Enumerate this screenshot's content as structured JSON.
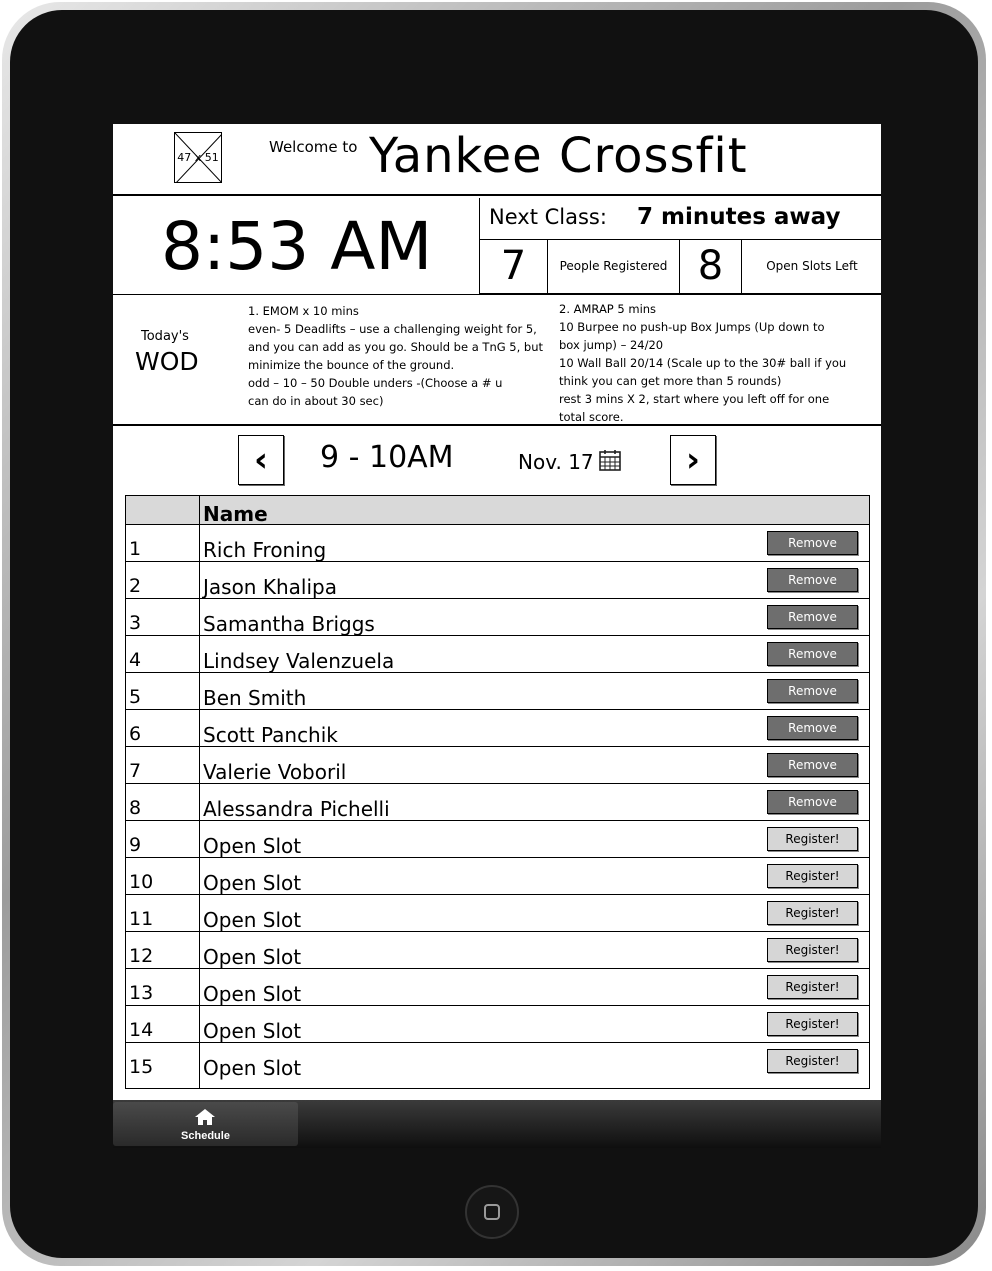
{
  "header": {
    "logo_text": "47 x 51",
    "welcome": "Welcome to",
    "title": "Yankee Crossfit"
  },
  "clock": "8:53 AM",
  "next_class": {
    "label": "Next Class:",
    "value": "7 minutes away"
  },
  "stats": {
    "registered_count": "7",
    "registered_label": "People Registered",
    "open_count": "8",
    "open_label": "Open Slots Left"
  },
  "wod": {
    "today": "Today's",
    "label": "WOD",
    "part1": [
      "1. EMOM x 10 mins",
      "even- 5 Deadlifts – use a challenging weight for 5,",
      "and you can add as you go. Should be a TnG 5, but",
      "minimize the bounce of the ground.",
      "odd – 10 – 50 Double unders -(Choose a # u",
      "can do in about 30 sec)"
    ],
    "part2": [
      "2. AMRAP 5 mins",
      "10 Burpee no push-up Box Jumps  (Up down to",
      "box jump) – 24/20",
      "10 Wall Ball 20/14 (Scale up to the 30# ball if you",
      "think you can get more than 5 rounds)",
      "rest 3 mins  X 2, start where you left off for one",
      "total score."
    ]
  },
  "schedule": {
    "slot": "9 - 10AM",
    "date": "Nov. 17",
    "prev_icon": "chevron-left-icon",
    "next_icon": "chevron-right-icon",
    "calendar_icon": "calendar-icon"
  },
  "table": {
    "header_name": "Name",
    "rows": [
      {
        "num": "1",
        "name": "Rich Froning",
        "action": "Remove"
      },
      {
        "num": "2",
        "name": "Jason Khalipa",
        "action": "Remove"
      },
      {
        "num": "3",
        "name": "Samantha Briggs",
        "action": "Remove"
      },
      {
        "num": "4",
        "name": "Lindsey Valenzuela",
        "action": "Remove"
      },
      {
        "num": "5",
        "name": "Ben Smith",
        "action": "Remove"
      },
      {
        "num": "6",
        "name": "Scott Panchik",
        "action": "Remove"
      },
      {
        "num": "7",
        "name": "Valerie Voboril",
        "action": "Remove"
      },
      {
        "num": "8",
        "name": "Alessandra Pichelli",
        "action": "Remove"
      },
      {
        "num": "9",
        "name": "Open Slot",
        "action": "Register!"
      },
      {
        "num": "10",
        "name": "Open Slot",
        "action": "Register!"
      },
      {
        "num": "11",
        "name": "Open Slot",
        "action": "Register!"
      },
      {
        "num": "12",
        "name": "Open Slot",
        "action": "Register!"
      },
      {
        "num": "13",
        "name": "Open Slot",
        "action": "Register!"
      },
      {
        "num": "14",
        "name": "Open Slot",
        "action": "Register!"
      },
      {
        "num": "15",
        "name": "Open Slot",
        "action": "Register!"
      }
    ]
  },
  "tabbar": {
    "tab_label": "Schedule",
    "tab_icon": "home-icon"
  }
}
